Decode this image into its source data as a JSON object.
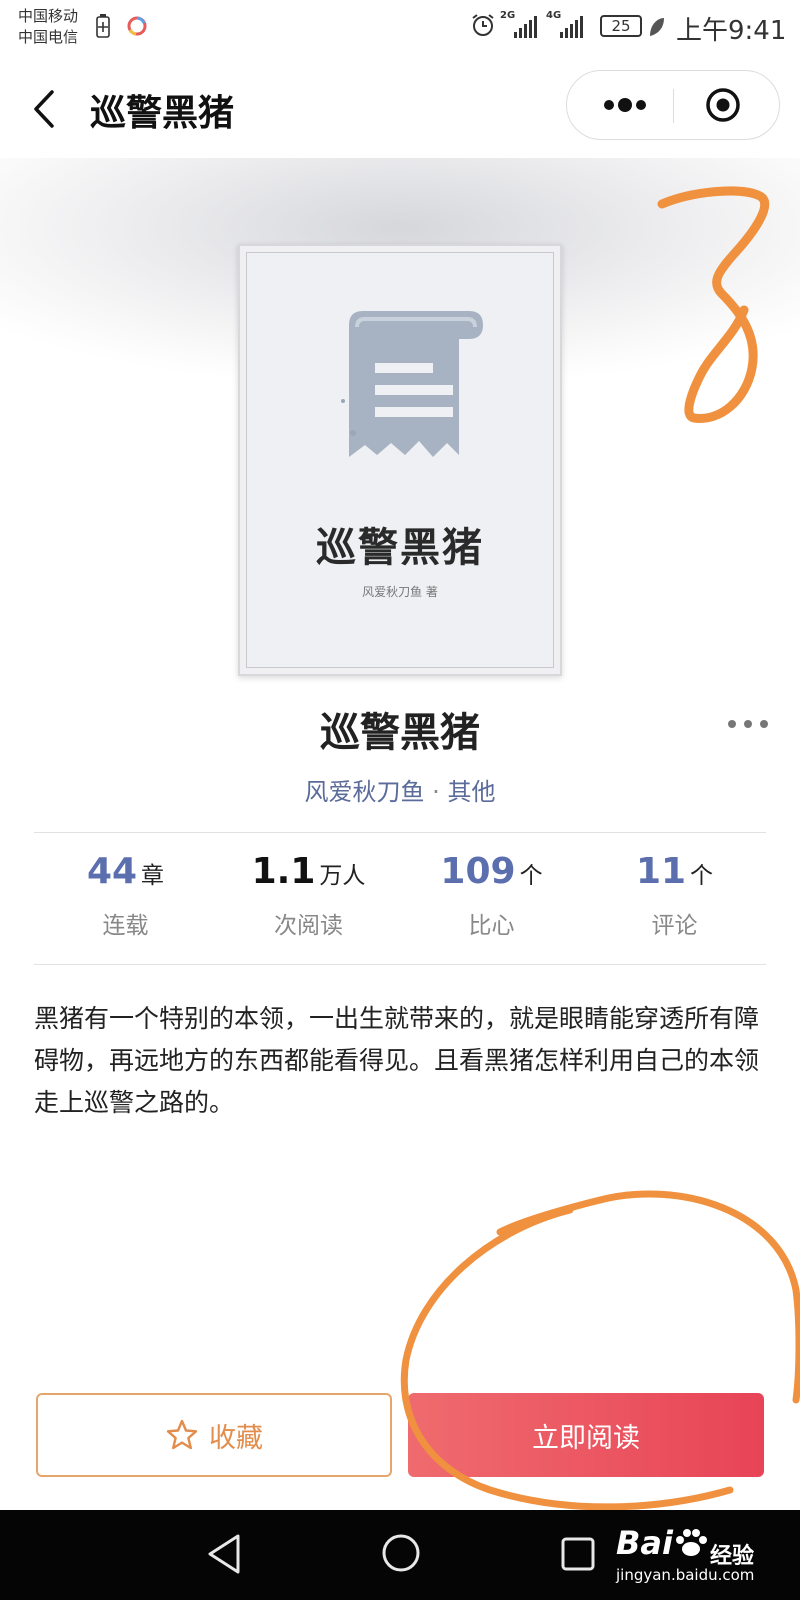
{
  "status_bar": {
    "carrier_1": "中国移动",
    "carrier_2": "中国电信",
    "net_1": "2G",
    "net_2": "4G",
    "battery": "25",
    "time": "上午9:41"
  },
  "nav": {
    "title": "巡警黑猪",
    "icons": [
      "back-icon",
      "more-dots-icon",
      "record-icon"
    ]
  },
  "cover": {
    "title": "巡警黑猪",
    "author_line": "风爱秋刀鱼 著"
  },
  "book": {
    "title": "巡警黑猪",
    "author": "风爱秋刀鱼",
    "separator": "·",
    "genre": "其他"
  },
  "stats": [
    {
      "value": "44",
      "unit": "章",
      "label": "连载"
    },
    {
      "value": "1.1",
      "unit": "万人",
      "label": "次阅读"
    },
    {
      "value": "109",
      "unit": "个",
      "label": "比心"
    },
    {
      "value": "11",
      "unit": "个",
      "label": "评论"
    }
  ],
  "synopsis": "黑猪有一个特别的本领，一出生就带来的，就是眼睛能穿透所有障碍物，再远地方的东西都能看得见。且看黑猪怎样利用自己的本领走上巡警之路的。",
  "actions": {
    "favorite_label": "收藏",
    "read_label": "立即阅读"
  },
  "colors": {
    "accent_blue": "#5b6faf",
    "favorite_orange": "#e28d4c",
    "read_red": "#e84457",
    "annotation_orange": "#f0913f"
  },
  "watermark": {
    "brand": "Bai",
    "sub": "经验",
    "url": "jingyan.baidu.com"
  }
}
